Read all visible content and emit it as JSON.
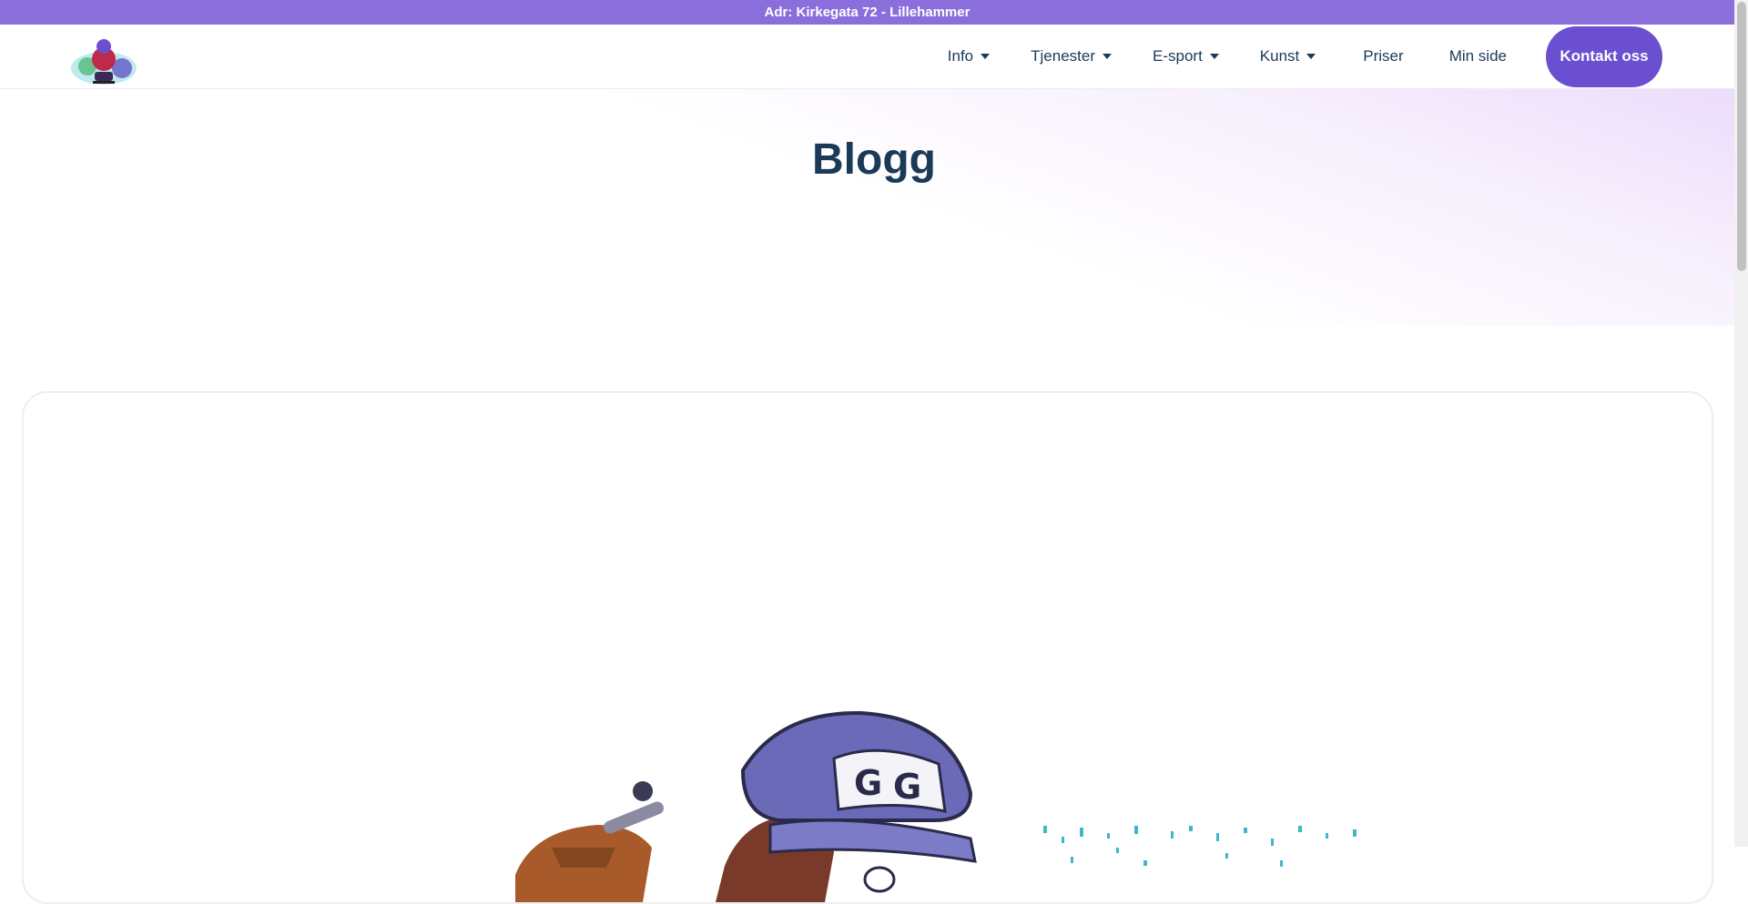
{
  "topbar": {
    "address": "Adr: Kirkegata 72 - Lillehammer"
  },
  "header": {
    "logo_icon": "gamer-mascot-logo",
    "nav": {
      "info": "Info",
      "tjenester": "Tjenester",
      "esport": "E-sport",
      "kunst": "Kunst",
      "priser": "Priser",
      "minside": "Min side",
      "kontakt": "Kontakt oss"
    }
  },
  "main": {
    "title": "Blogg",
    "featured_image_icon": "gamer-mascot-illustration"
  },
  "colors": {
    "topbar": "#8a6fdc",
    "cta": "#6b4fd1",
    "text": "#1b3a57",
    "hero_tint": "#ecdcfb"
  }
}
